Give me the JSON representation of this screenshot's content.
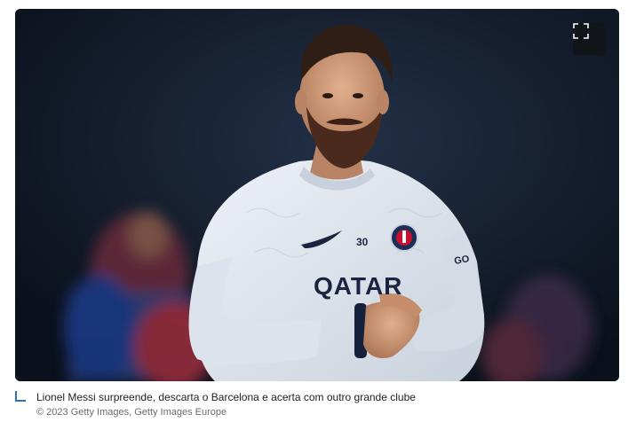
{
  "caption": {
    "title": "Lionel Messi surpreende, descarta o Barcelona e acerta com outro grande clube",
    "credit": "© 2023 Getty Images, Getty Images Europe"
  },
  "photo": {
    "jersey_sponsor": "QATAR",
    "jersey_number": "30",
    "subject": "Lionel Messi"
  },
  "toolbar": {
    "expand_icon": "fullscreen-icon"
  },
  "colors": {
    "caption_accent": "#2f6fbf",
    "expand_button_bg": "#111418"
  }
}
